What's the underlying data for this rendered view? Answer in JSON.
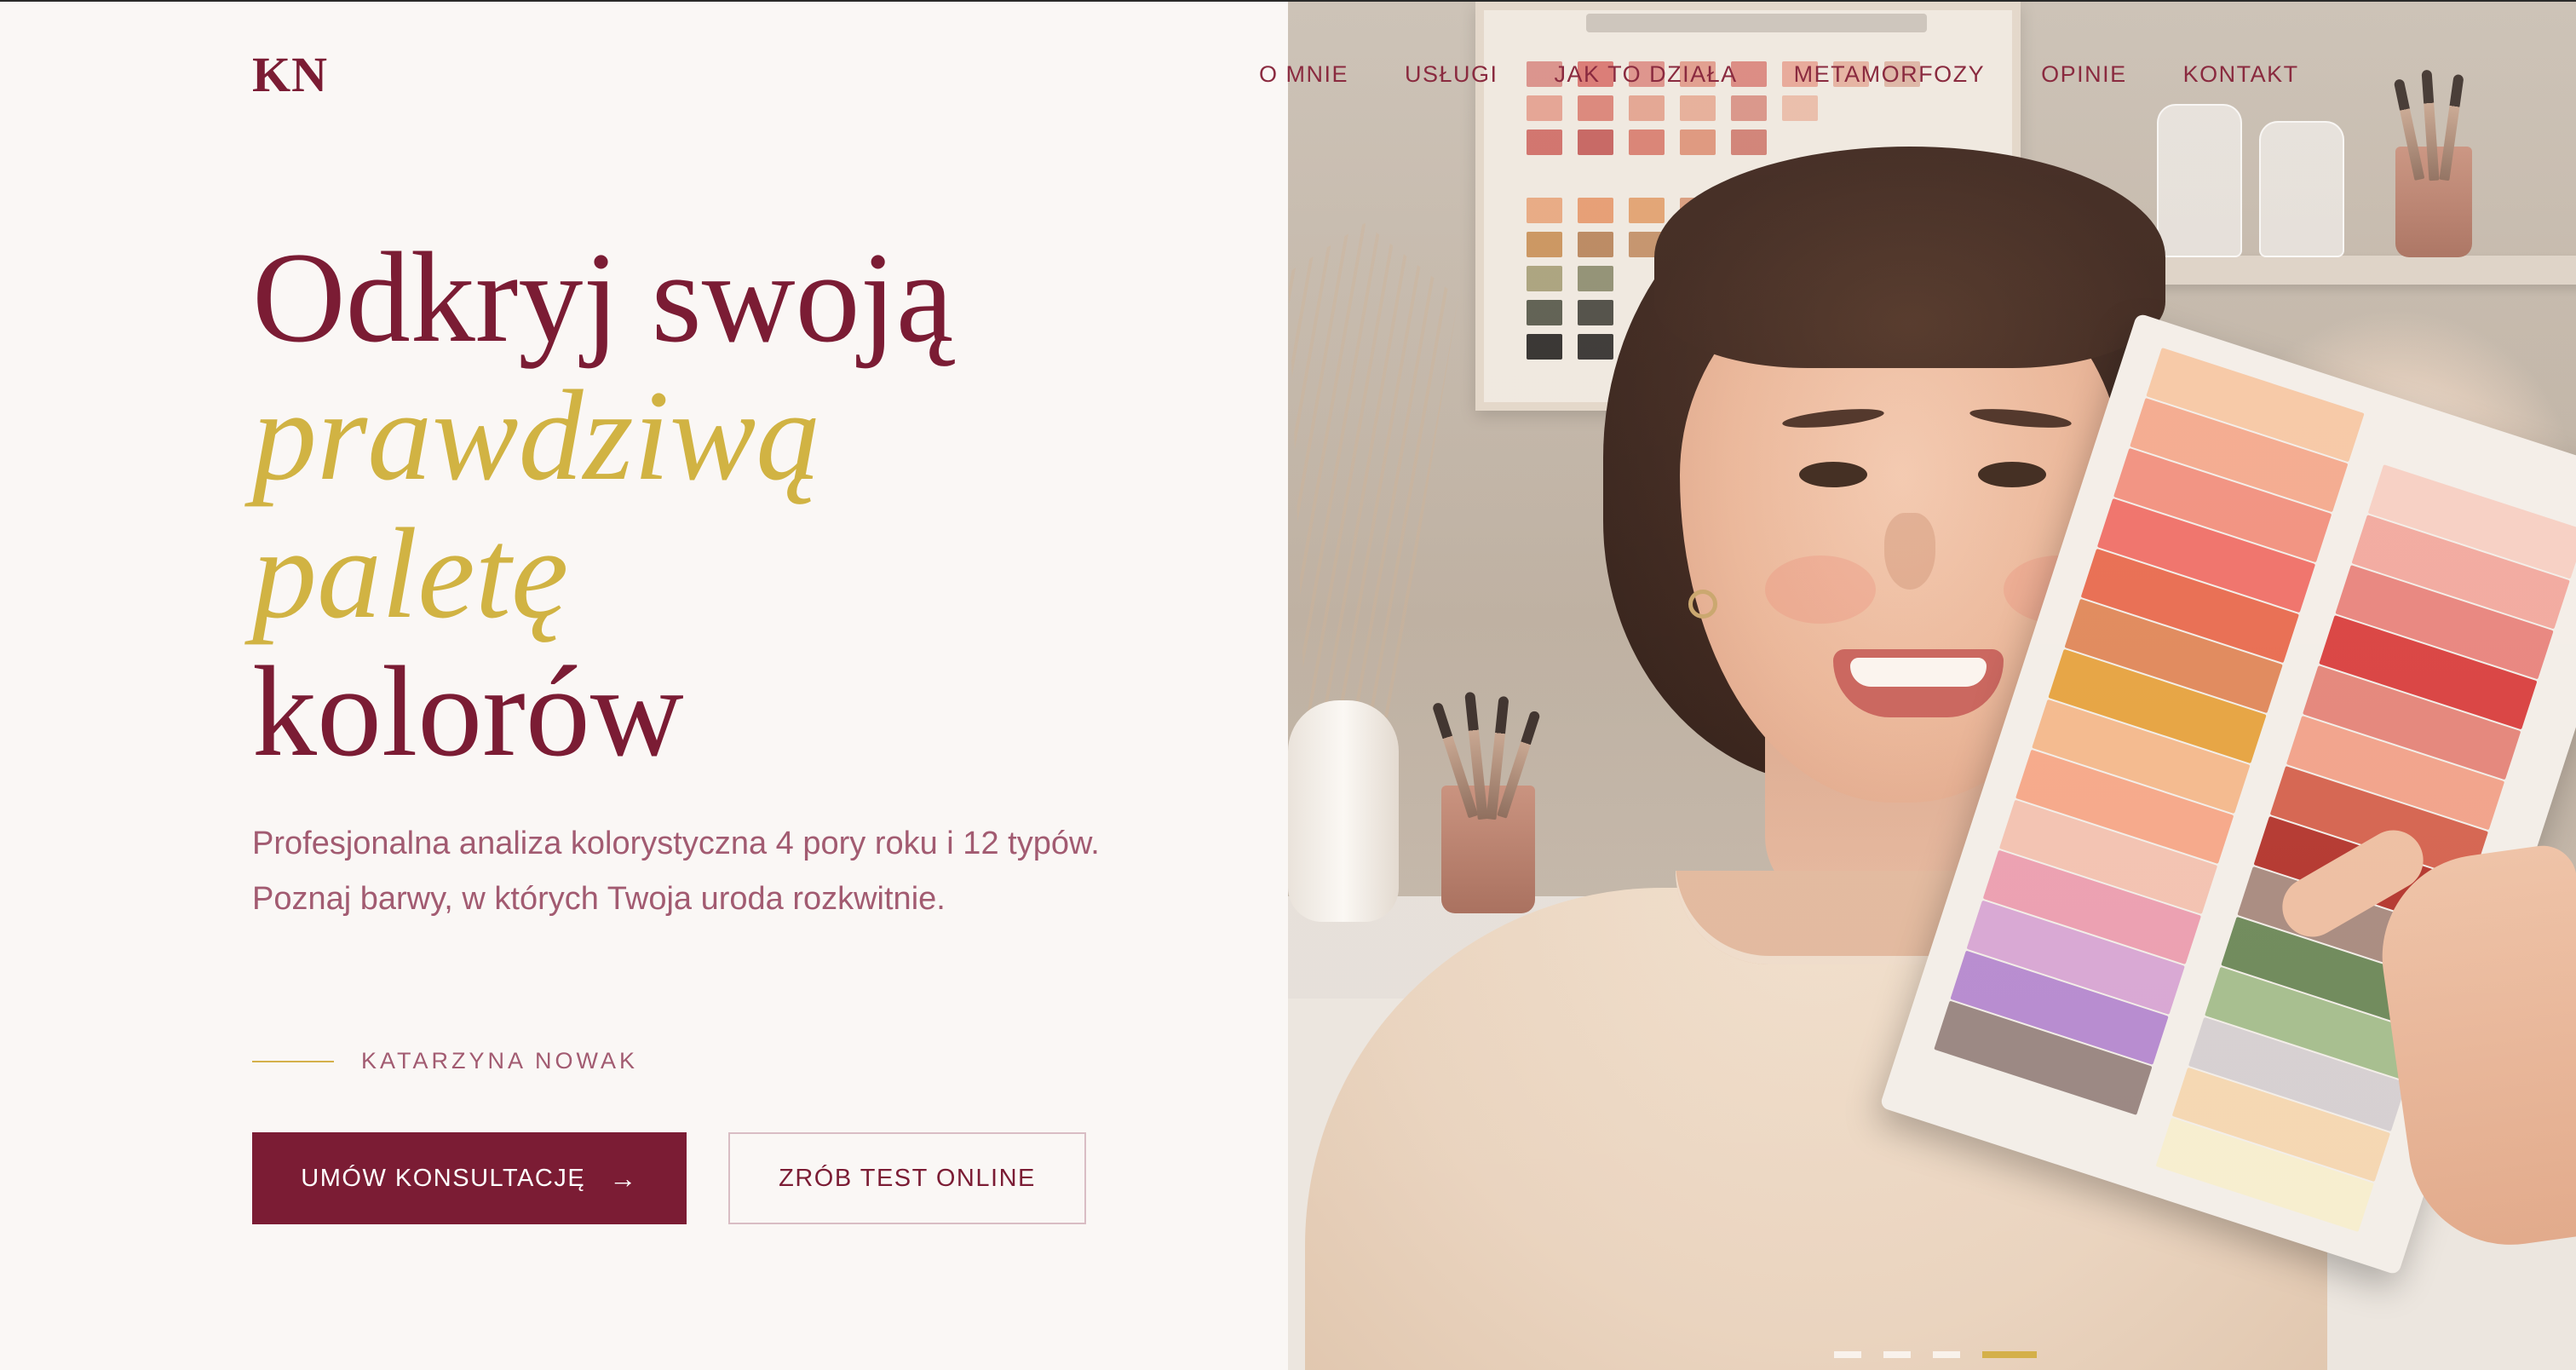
{
  "header": {
    "logo": "KN",
    "nav": [
      {
        "label": "O MNIE"
      },
      {
        "label": "USŁUGI"
      },
      {
        "label": "JAK TO DZIAŁA"
      },
      {
        "label": "METAMORFOZY"
      },
      {
        "label": "OPINIE"
      },
      {
        "label": "KONTAKT"
      }
    ]
  },
  "hero": {
    "headline": {
      "line1": "Odkryj swoją",
      "line2": "prawdziwą",
      "line3": "paletę",
      "line4": "kolorów"
    },
    "intro": "Profesjonalna analiza kolorystyczna 4 pory roku i 12 typów. Poznaj barwy, w których Twoja uroda rozkwitnie.",
    "signature": "KATARZYNA NOWAK",
    "primary_button": "UMÓW KONSULTACJĘ",
    "primary_button_icon": "arrow-right-icon",
    "secondary_button": "ZRÓB TEST ONLINE",
    "slider": {
      "total": 4,
      "active": 4
    }
  },
  "colors": {
    "brand": "#7b1c34",
    "accent_gold": "#d1b343",
    "text_muted": "#a25b71",
    "background": "#faf7f5"
  }
}
